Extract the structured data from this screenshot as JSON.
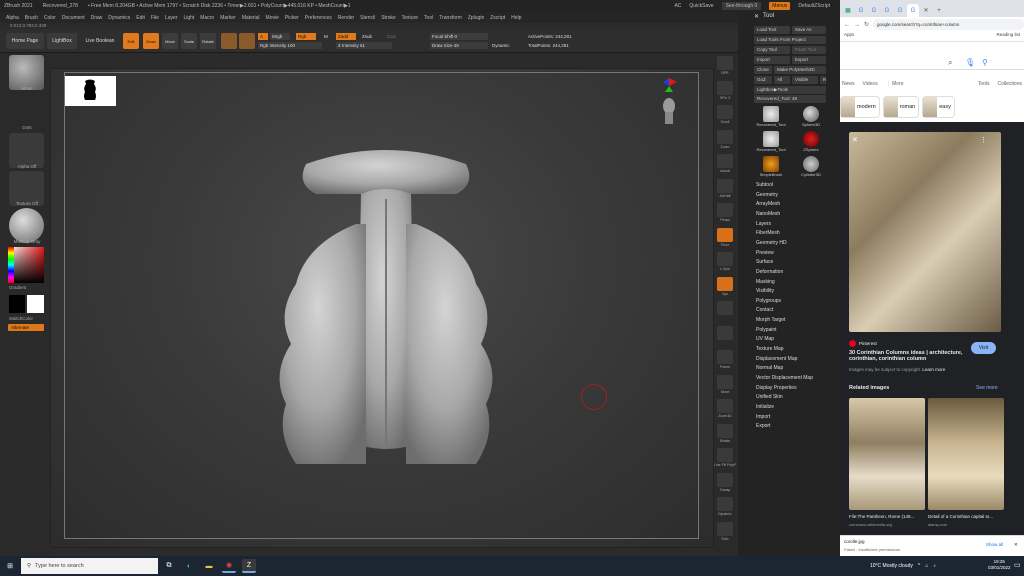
{
  "zbrush": {
    "title_items": [
      "ZBrush 2021",
      "Recovered_278",
      "• Free Mem 8.204GB • Active Mem 1797 • Scratch Disk 2236 • Timer▶2.601 • PolyCount▶445.016 KP • MeshCount▶1"
    ],
    "ac": "AC",
    "quicksave": "QuickSave",
    "see_through": "See-through 0",
    "menus_btn": "Menus",
    "default_script": "DefaultZScript",
    "menu": [
      "Alpha",
      "Brush",
      "Color",
      "Document",
      "Draw",
      "Dynamics",
      "Edit",
      "File",
      "Layer",
      "Light",
      "Macro",
      "Marker",
      "Material",
      "Movie",
      "Picker",
      "Preferences",
      "Render",
      "Stencil",
      "Stroke",
      "Texture",
      "Tool",
      "Transform",
      "Zplugin",
      "Zscript",
      "Help"
    ],
    "coords": "0.012,0.783,0.339",
    "shelf": {
      "home": "Home Page",
      "lightbox": "LightBox",
      "live_boolean": "Live Boolean",
      "edit": "Edit",
      "draw": "Draw",
      "move": "Move",
      "scale": "Scale",
      "rotate": "Rotate",
      "a": "A",
      "mrgb": "Mrgb",
      "rgb": "Rgb",
      "m": "M",
      "rgb_intensity": "Rgb Intensity 100",
      "zadd": "Zadd",
      "zsub": "Zsub",
      "zcut": "Zcut",
      "z_intensity": "Z Intensity 51",
      "focal_shift": "Focal Shift 0",
      "draw_size": "Draw Size 49",
      "dynamic": "Dynamic",
      "active_points": "ActivePoints: 244,281",
      "total_points": "TotalPoints: 244,281"
    },
    "left": {
      "move": "Move",
      "dots": "Dots",
      "alpha_off": "Alpha Off",
      "texture_off": "Texture Off",
      "matcap": "MatCap Gray",
      "gradient": "Gradient",
      "switch_color": "SwitchColor",
      "alternate": "Alternate"
    },
    "strip": [
      "BPR",
      "SPix 3",
      "Scroll",
      "Zoom",
      "Actual",
      "AAHalf",
      "Persp",
      "Floor",
      "L.Sym",
      "Xyz",
      "",
      "",
      "Frame",
      "Move",
      "Zoom3D",
      "Rotate",
      "Line Fill PolyF",
      "Transp",
      "Dynamic",
      "Solo"
    ],
    "tool": {
      "title": "Tool",
      "load": "Load Tool",
      "save_as": "Save As",
      "load_project": "Load Tools From Project",
      "copy": "Copy Tool",
      "paste": "Paste Tool",
      "import": "Import",
      "export": "Export",
      "clone": "Clone",
      "make_polymesh": "Make PolyMesh3D",
      "goz": "GoZ",
      "all": "All",
      "visible": "Visible",
      "r": "R",
      "lightbox_tools": "Lightbox▶Tools",
      "recovered_tool": "Recovered_Tool: 48",
      "thumbs": [
        "Recovered_Tool",
        "Sphere3D",
        "Recovered_Tool",
        "ZSphere",
        "SimpleBrush",
        "Cylinder3D"
      ],
      "list": [
        "Subtool",
        "Geometry",
        "ArrayMesh",
        "NanoMesh",
        "Layers",
        "FiberMesh",
        "Geometry HD",
        "Preview",
        "Surface",
        "Deformation",
        "Masking",
        "Visibility",
        "Polygroups",
        "Contact",
        "Morph Target",
        "Polypaint",
        "UV Map",
        "Texture Map",
        "Displacement Map",
        "Normal Map",
        "Vector Displacement Map",
        "Display Properties",
        "Unified Skin",
        "Initialize",
        "Import",
        "Export"
      ]
    }
  },
  "chrome": {
    "url": "google.com/search?q=corinthian+column",
    "apps": "Apps",
    "reading_list": "Reading list",
    "g_tabs": [
      "News",
      "Videos",
      "⋮ More",
      "Tools"
    ],
    "chips": [
      "modern",
      "roman",
      "easy"
    ],
    "collections": "Collections",
    "source": "Pinterest",
    "title": "30 Corinthian Columns ideas | architecture, corinthian, corinthian column",
    "copyright": "Images may be subject to copyright.",
    "learn_more": "Learn more",
    "visit": "Visit",
    "related": "Related images",
    "see_more": "See more",
    "rel": [
      {
        "cap": "File:The Pantheon, Rome (149...",
        "src": "commons.wikimedia.org"
      },
      {
        "cap": "Detail of a Corinthian capital to...",
        "src": "alamy.com"
      }
    ],
    "download": {
      "name": "corolle.jpg",
      "status": "Failed - Insufficient permissions",
      "show_all": "Show all"
    }
  },
  "taskbar": {
    "search": "Type here to search",
    "weather": "10°C  Mostly cloudy",
    "time": "19:25",
    "date": "03/01/2022"
  },
  "colors": {
    "accent": "#e07a1c",
    "zb_bg": "#2b2b2b",
    "chrome_dark": "#202124",
    "link": "#8ab4f8"
  }
}
